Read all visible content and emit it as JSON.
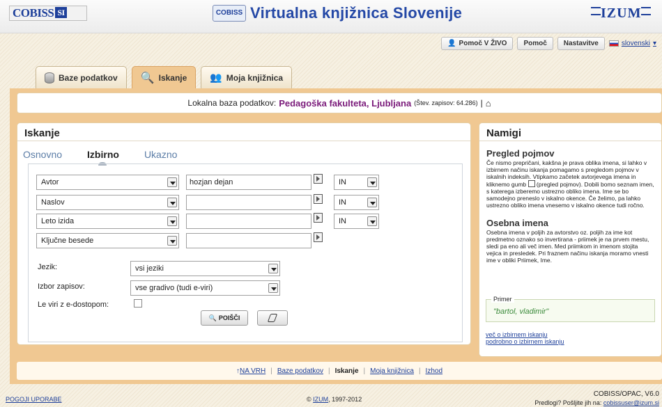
{
  "header": {
    "cobiss_logo": "COBISS",
    "cobiss_logo_box": "SI",
    "site_title": "Virtualna knjižnica Slovenije",
    "site_icon_text": "COBISS",
    "izum_logo": "IZUM",
    "live_help": "Pomoč V ŽIVO",
    "help": "Pomoč",
    "settings": "Nastavitve",
    "language": "slovenski"
  },
  "tabs": [
    {
      "label": "Baze podatkov"
    },
    {
      "label": "Iskanje"
    },
    {
      "label": "Moja knjižnica"
    }
  ],
  "banner": {
    "prefix": "Lokalna baza podatkov:",
    "library": "Pedagoška fakulteta, Ljubljana",
    "count": "(Štev. zapisov: 64.286)",
    "sep": "|"
  },
  "search": {
    "title": "Iskanje",
    "subtabs": [
      "Osnovno",
      "Izbirno",
      "Ukazno"
    ],
    "rows": [
      {
        "field": "Avtor",
        "value": "hozjan dejan",
        "op": "IN"
      },
      {
        "field": "Naslov",
        "value": "",
        "op": "IN"
      },
      {
        "field": "Leto izida",
        "value": "",
        "op": "IN"
      },
      {
        "field": "Ključne besede",
        "value": ""
      }
    ],
    "language_label": "Jezik:",
    "language_value": "vsi jeziki",
    "selection_label": "Izbor zapisov:",
    "selection_value": "vse gradivo (tudi e-viri)",
    "eaccess_label": "Le viri z e-dostopom:",
    "search_button": "POIŠČI"
  },
  "tips": {
    "title": "Namigi",
    "h1": "Pregled pojmov",
    "p1a": "Če nismo prepričani, kakšna je prava oblika imena, si lahko v izbirnem načinu iskanja pomagamo s pregledom pojmov v iskalnih indeksih. Vtipkamo začetek avtorjevega imena in kliknemo gumb",
    "p1b": "(pregled pojmov). Dobili bomo seznam imen, s katerega izberemo ustrezno obliko imena. Ime se bo samodejno preneslo v iskalno okence. Če želimo, pa lahko ustrezno obliko imena vnesemo v iskalno okence tudi ročno.",
    "h2": "Osebna imena",
    "p2": "Osebna imena v poljih za avtorstvo oz. poljih za ime kot predmetno oznako so invertirana - priimek je na prvem mestu, sledi pa eno ali več imen. Med priimkom in imenom stojita vejica in presledek. Pri fraznem načinu iskanja moramo vnesti ime v obliki Priimek, Ime.",
    "primer_label": "Primer",
    "primer_example": "\"bartol, vladimir\"",
    "link1": "več o izbirnem iskanju",
    "link2": "podrobno o izbirnem iskanju"
  },
  "footer": {
    "top": "NA VRH",
    "db": "Baze podatkov",
    "search": "Iskanje",
    "mylib": "Moja knjižnica",
    "exit": "Izhod"
  },
  "bottom": {
    "terms": "POGOJI UPORABE",
    "copyright_prefix": "©",
    "izum": "IZUM",
    "years": ", 1997-2012",
    "version": "COBISS/OPAC, V6.0",
    "suggest_prefix": "Predlogi? Pošljite jih na:",
    "email": "cobissuser@izum.si"
  }
}
